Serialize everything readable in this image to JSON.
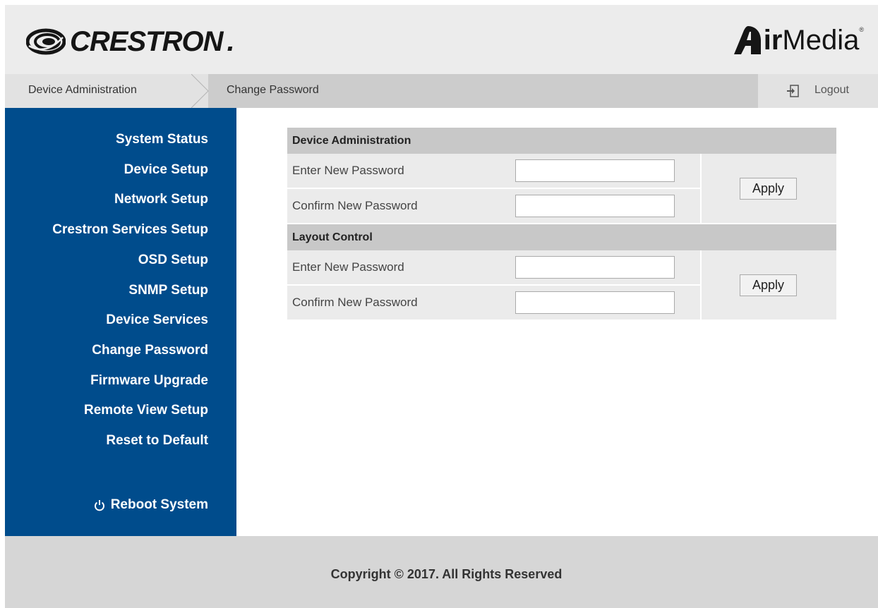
{
  "header": {
    "brand_name": "CRESTRON",
    "brand_tm": ".",
    "product_name_bold": "ir",
    "product_name_light": "Media",
    "product_reg": "®"
  },
  "breadcrumb": {
    "items": [
      "Device Administration",
      "Change Password"
    ],
    "logout_label": "Logout"
  },
  "sidebar": {
    "items": [
      "System Status",
      "Device Setup",
      "Network Setup",
      "Crestron Services Setup",
      "OSD Setup",
      "SNMP Setup",
      "Device Services",
      "Change Password",
      "Firmware Upgrade",
      "Remote View Setup",
      "Reset to Default"
    ],
    "reboot_label": "Reboot System",
    "background_color": "#004c8c"
  },
  "panels": [
    {
      "title": "Device Administration",
      "new_password_label": "Enter New Password",
      "confirm_password_label": "Confirm New Password",
      "new_password_value": "",
      "confirm_password_value": "",
      "apply_label": "Apply"
    },
    {
      "title": "Layout Control",
      "new_password_label": "Enter New Password",
      "confirm_password_label": "Confirm New Password",
      "new_password_value": "",
      "confirm_password_value": "",
      "apply_label": "Apply"
    }
  ],
  "footer": {
    "copyright": "Copyright © 2017. All Rights Reserved"
  },
  "icons": {
    "brand": "crestron-swirl-icon",
    "product": "airmedia-a-icon",
    "logout": "logout-icon",
    "reboot": "power-icon",
    "breadcrumb_separator": "chevron-right-icon"
  }
}
